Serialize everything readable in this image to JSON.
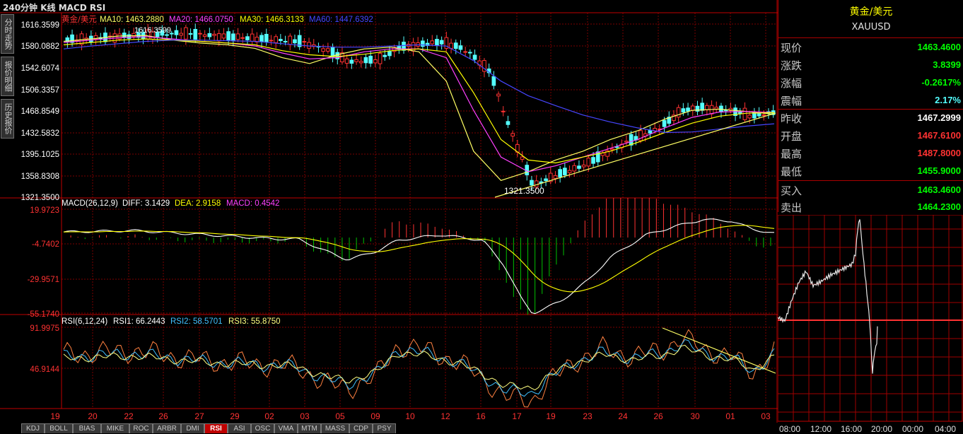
{
  "header": {
    "title": "240分钟 K线 MACD RSI"
  },
  "side_tabs": [
    "分时走势",
    "报价明细",
    "历史报价"
  ],
  "colors": {
    "up": "#ff3232",
    "down": "#54ffff",
    "grid": "#7a0000",
    "ma10": "#ffff64",
    "ma20": "#ff40ff",
    "ma30": "#ffff00",
    "ma60": "#4646ff",
    "diff": "#ffffff",
    "dea": "#ffff00",
    "rsi1": "#ff8040",
    "rsi2": "#40c0ff",
    "rsi3": "#ffff80"
  },
  "price_panel": {
    "legend_name": "黄金/美元",
    "ma10_label": "MA10: 1463.2880",
    "ma20_label": "MA20: 1466.0750",
    "ma30_label": "MA30: 1466.3133",
    "ma60_label": "MA60: 1447.6392",
    "y_ticks": [
      "1616.3599",
      "1580.0882",
      "1542.6074",
      "1506.3357",
      "1468.8549",
      "1432.5832",
      "1395.1025",
      "1358.8308",
      "1321.3500"
    ],
    "high_annotation": "1616.3599",
    "low_annotation": "1321.3500"
  },
  "macd_panel": {
    "label": "MACD(26,12,9)",
    "diff_label": "DIFF: 3.1429",
    "dea_label": "DEA: 2.9158",
    "macd_label": "MACD: 0.4542",
    "y_ticks": [
      "19.9723",
      "-4.7402",
      "-29.9571",
      "-55.1740"
    ]
  },
  "rsi_panel": {
    "label": "RSI(6,12,24)",
    "rsi1_label": "RSI1: 66.2443",
    "rsi2_label": "RSI2: 58.5701",
    "rsi3_label": "RSI3: 55.8750",
    "y_ticks": [
      "91.9975",
      "46.9144"
    ]
  },
  "x_axis": {
    "ticks": [
      "19",
      "20",
      "22",
      "26",
      "27",
      "29",
      "02",
      "03",
      "05",
      "09",
      "10",
      "12",
      "16",
      "17",
      "19",
      "23",
      "24",
      "26",
      "30",
      "01",
      "03"
    ]
  },
  "bottom_tabs": [
    "KDJ",
    "BOLL",
    "BIAS",
    "MIKE",
    "ROC",
    "ARBR",
    "DMI",
    "RSI",
    "ASI",
    "OSC",
    "VMA",
    "MTM",
    "MASS",
    "CDP",
    "PSY"
  ],
  "active_tab": "RSI",
  "quote": {
    "name": "黄金/美元",
    "code": "XAUUSD",
    "rows": [
      {
        "label": "现价",
        "value": "1463.4600",
        "color": "#00ff00"
      },
      {
        "label": "涨跌",
        "value": "3.8399",
        "color": "#00ff00"
      },
      {
        "label": "涨幅",
        "value": "-0.2617%",
        "color": "#00ff00"
      },
      {
        "label": "震幅",
        "value": "2.17%",
        "color": "#54ffff"
      },
      {
        "label": "昨收",
        "value": "1467.2999",
        "color": "#ffffff"
      },
      {
        "label": "开盘",
        "value": "1467.6100",
        "color": "#ff3232"
      },
      {
        "label": "最高",
        "value": "1487.8000",
        "color": "#ff3232"
      },
      {
        "label": "最低",
        "value": "1455.9000",
        "color": "#00ff00"
      },
      {
        "label": "买入",
        "value": "1463.4600",
        "color": "#00ff00"
      },
      {
        "label": "卖出",
        "value": "1464.2300",
        "color": "#00ff00"
      }
    ]
  },
  "intraday": {
    "x_ticks": [
      "08:00",
      "12:00",
      "16:00",
      "20:00",
      "00:00",
      "04:00"
    ]
  },
  "chart_data": {
    "type": "line",
    "title": "240分钟 K线 MACD RSI",
    "series": [
      {
        "name": "MA10",
        "values": [
          1588,
          1592,
          1597,
          1598,
          1590,
          1585,
          1582,
          1576,
          1560,
          1550,
          1565,
          1575,
          1578,
          1570,
          1520,
          1400,
          1350,
          1365,
          1385,
          1400,
          1420,
          1435,
          1455,
          1470,
          1472,
          1468,
          1463
        ]
      },
      {
        "name": "MA20",
        "values": [
          1586,
          1590,
          1594,
          1596,
          1592,
          1588,
          1585,
          1580,
          1568,
          1558,
          1560,
          1570,
          1575,
          1575,
          1560,
          1470,
          1390,
          1365,
          1375,
          1390,
          1405,
          1420,
          1440,
          1458,
          1467,
          1468,
          1466
        ]
      },
      {
        "name": "MA30",
        "values": [
          1582,
          1586,
          1590,
          1592,
          1590,
          1588,
          1585,
          1582,
          1572,
          1565,
          1562,
          1566,
          1572,
          1575,
          1570,
          1500,
          1420,
          1385,
          1380,
          1390,
          1400,
          1415,
          1432,
          1448,
          1460,
          1465,
          1466
        ]
      },
      {
        "name": "MA60",
        "values": [
          1575,
          1580,
          1584,
          1588,
          1590,
          1590,
          1589,
          1588,
          1584,
          1580,
          1578,
          1578,
          1580,
          1582,
          1580,
          1555,
          1520,
          1495,
          1478,
          1462,
          1450,
          1440,
          1432,
          1433,
          1438,
          1443,
          1447
        ]
      }
    ]
  }
}
